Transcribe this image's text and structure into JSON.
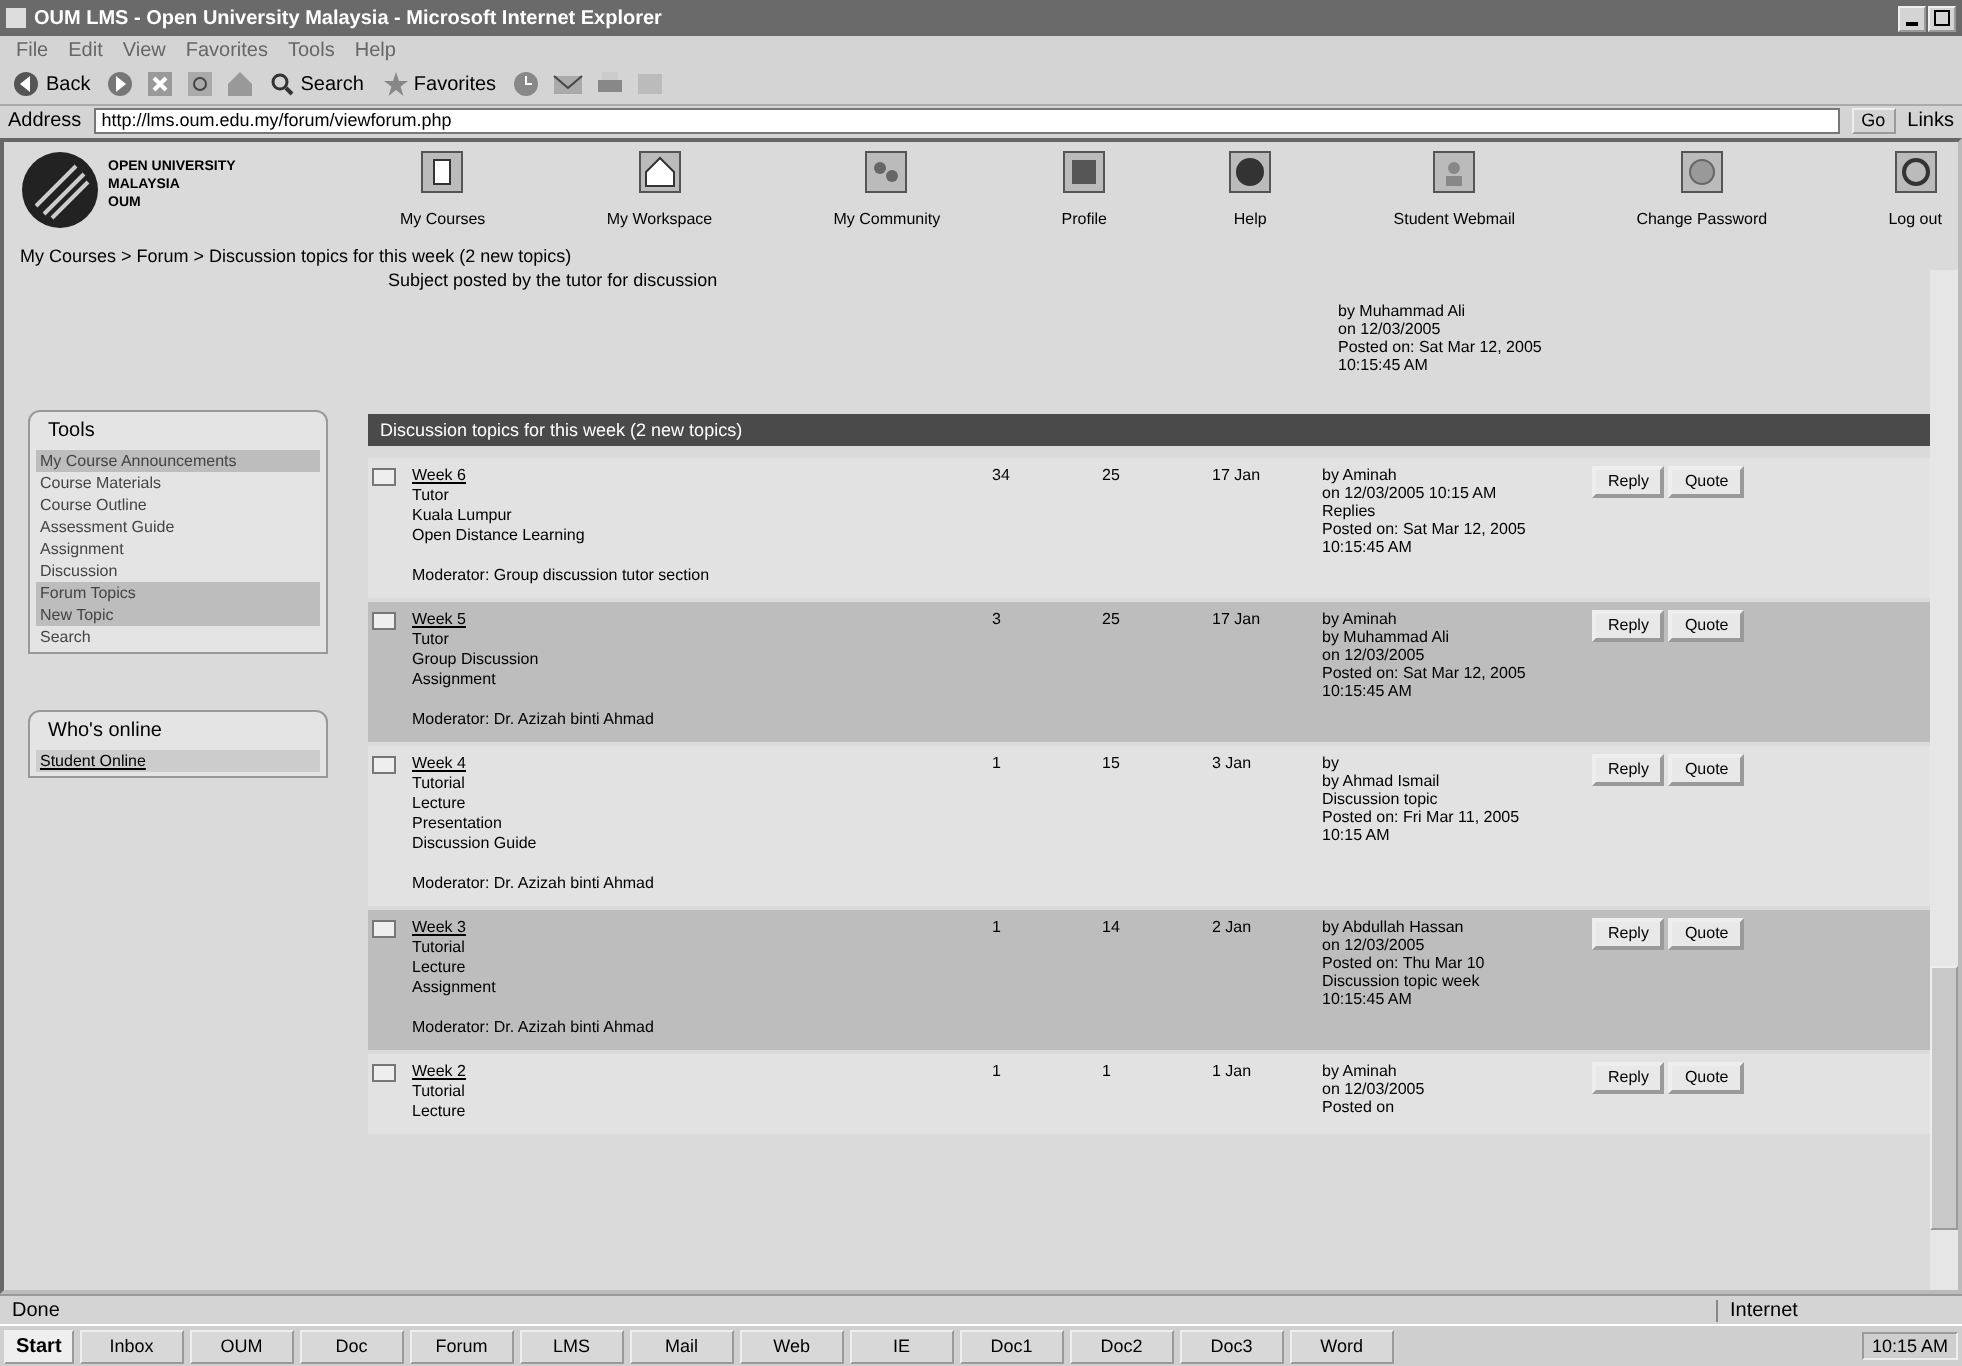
{
  "window": {
    "title": "OUM LMS - Open University Malaysia - Microsoft Internet Explorer"
  },
  "menu": [
    "File",
    "Edit",
    "View",
    "Favorites",
    "Tools",
    "Help"
  ],
  "toolbar_labels": [
    "Back",
    "Search",
    "Favorites"
  ],
  "address": {
    "label": "Address",
    "value": "http://lms.oum.edu.my/forum/viewforum.php",
    "go": "Go",
    "links": "Links"
  },
  "logo": {
    "lines": [
      "OPEN UNIVERSITY",
      "MALAYSIA",
      "OUM"
    ]
  },
  "nav": [
    "My Courses",
    "My Workspace",
    "My Community",
    "Profile",
    "Help",
    "Student Webmail",
    "Change Password",
    "Log out"
  ],
  "breadcrumb": "My Courses > Forum > Discussion topics for this week (2 new topics)",
  "top_row": {
    "text": "Subject posted by the tutor for discussion",
    "last_post": [
      "by Muhammad Ali",
      "on 12/03/2005",
      "Posted on: Sat Mar 12, 2005",
      "10:15:45 AM"
    ]
  },
  "sidebar": {
    "title": "Tools",
    "items": [
      {
        "label": "My Course Announcements",
        "selected": true
      },
      {
        "label": "Course Materials",
        "selected": false
      },
      {
        "label": "  Course Outline",
        "selected": false
      },
      {
        "label": "  Assessment Guide",
        "selected": false
      },
      {
        "label": "Assignment",
        "selected": false
      },
      {
        "label": "Discussion",
        "selected": false
      },
      {
        "label": "Forum Topics",
        "selected": true
      },
      {
        "label": "  New Topic",
        "selected": true
      },
      {
        "label": "Search",
        "selected": false
      }
    ],
    "online_title": "Who's online",
    "online_link": "Student Online"
  },
  "table": {
    "header": "Discussion topics for this week (2 new topics)",
    "rows": [
      {
        "highlighted": false,
        "buttons": [
          "Reply",
          "Quote"
        ],
        "title": "Week 6",
        "lines": [
          "Tutor",
          "Kuala Lumpur",
          "Open Distance Learning"
        ],
        "footer": "Moderator: Group discussion tutor section",
        "replies": "34",
        "views": "25",
        "date": "17 Jan",
        "last_post": [
          "by Aminah",
          "on 12/03/2005 10:15 AM",
          "Replies",
          "Posted on: Sat Mar 12, 2005",
          "10:15:45 AM"
        ]
      },
      {
        "highlighted": true,
        "buttons": [
          "Reply",
          "Quote"
        ],
        "title": "Week 5",
        "lines": [
          "Tutor",
          "Group Discussion",
          "Assignment"
        ],
        "footer": "Moderator: Dr. Azizah binti Ahmad",
        "replies": "3",
        "views": "25",
        "date": "17 Jan",
        "last_post": [
          "by Aminah",
          "by Muhammad Ali",
          "on 12/03/2005",
          "Posted on: Sat Mar 12, 2005",
          "10:15:45 AM"
        ]
      },
      {
        "highlighted": false,
        "buttons": [
          "Reply",
          "Quote"
        ],
        "title": "Week 4",
        "lines": [
          "Tutorial",
          "Lecture",
          "Presentation",
          "Discussion Guide"
        ],
        "footer": "Moderator: Dr. Azizah binti Ahmad",
        "replies": "1",
        "views": "15",
        "date": "3 Jan",
        "last_post": [
          "by",
          "by Ahmad Ismail",
          "Discussion topic",
          "Posted on: Fri Mar 11, 2005",
          "10:15 AM"
        ]
      },
      {
        "highlighted": true,
        "buttons": [
          "Reply",
          "Quote"
        ],
        "title": "Week 3",
        "lines": [
          "Tutorial",
          "Lecture",
          "Assignment"
        ],
        "footer": "Moderator: Dr. Azizah binti Ahmad",
        "replies": "1",
        "views": "14",
        "date": "2 Jan",
        "last_post": [
          "by Abdullah Hassan",
          "on 12/03/2005",
          "Posted on: Thu Mar 10",
          "Discussion topic week",
          "10:15:45 AM"
        ]
      },
      {
        "highlighted": false,
        "buttons": [
          "Reply",
          "Quote"
        ],
        "title": "Week 2",
        "lines": [
          "Tutorial",
          "Lecture"
        ],
        "replies": "1",
        "views": "1",
        "date": "1 Jan",
        "last_post": [
          "by Aminah",
          "on 12/03/2005",
          "Posted on"
        ]
      }
    ]
  },
  "status_bar": {
    "text": "Done",
    "zone": "Internet"
  },
  "taskbar": {
    "start": "Start",
    "tasks": [
      "Inbox",
      "OUM",
      "Doc",
      "Forum",
      "LMS",
      "Mail",
      "Web",
      "IE",
      "Doc1",
      "Doc2",
      "Doc3",
      "Word"
    ],
    "clock": "10:15 AM"
  }
}
